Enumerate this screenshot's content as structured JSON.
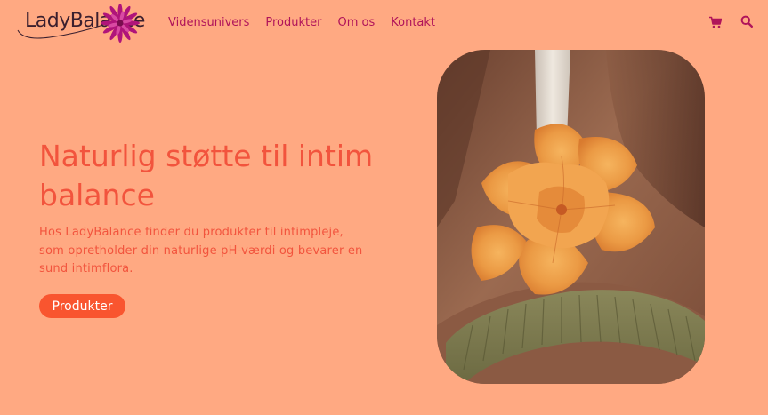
{
  "header": {
    "logo_text": "LadyBalance",
    "nav": [
      {
        "label": "Vidensunivers"
      },
      {
        "label": "Produkter"
      },
      {
        "label": "Om os"
      },
      {
        "label": "Kontakt"
      }
    ],
    "icons": [
      "cart-icon",
      "search-icon"
    ]
  },
  "hero": {
    "title": "Naturlig støtte til intim balance",
    "text": "Hos LadyBalance finder du produkter til intimpleje, som opretholder din naturlige pH-værdi og bevarer en sund intimflora.",
    "button_label": "Produkter"
  },
  "colors": {
    "background": "#ffa982",
    "nav_text": "#b0145a",
    "heading": "#f2543d",
    "button": "#f9552f",
    "logo_flower": "#b0147a"
  }
}
